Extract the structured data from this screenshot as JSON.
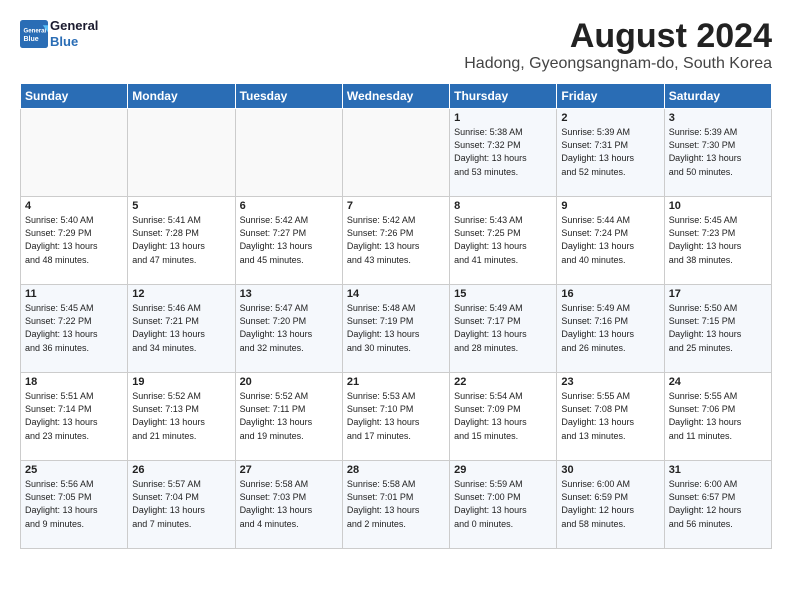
{
  "header": {
    "logo_line1": "General",
    "logo_line2": "Blue",
    "month_title": "August 2024",
    "subtitle": "Hadong, Gyeongsangnam-do, South Korea"
  },
  "weekdays": [
    "Sunday",
    "Monday",
    "Tuesday",
    "Wednesday",
    "Thursday",
    "Friday",
    "Saturday"
  ],
  "weeks": [
    [
      {
        "day": "",
        "content": ""
      },
      {
        "day": "",
        "content": ""
      },
      {
        "day": "",
        "content": ""
      },
      {
        "day": "",
        "content": ""
      },
      {
        "day": "1",
        "content": "Sunrise: 5:38 AM\nSunset: 7:32 PM\nDaylight: 13 hours\nand 53 minutes."
      },
      {
        "day": "2",
        "content": "Sunrise: 5:39 AM\nSunset: 7:31 PM\nDaylight: 13 hours\nand 52 minutes."
      },
      {
        "day": "3",
        "content": "Sunrise: 5:39 AM\nSunset: 7:30 PM\nDaylight: 13 hours\nand 50 minutes."
      }
    ],
    [
      {
        "day": "4",
        "content": "Sunrise: 5:40 AM\nSunset: 7:29 PM\nDaylight: 13 hours\nand 48 minutes."
      },
      {
        "day": "5",
        "content": "Sunrise: 5:41 AM\nSunset: 7:28 PM\nDaylight: 13 hours\nand 47 minutes."
      },
      {
        "day": "6",
        "content": "Sunrise: 5:42 AM\nSunset: 7:27 PM\nDaylight: 13 hours\nand 45 minutes."
      },
      {
        "day": "7",
        "content": "Sunrise: 5:42 AM\nSunset: 7:26 PM\nDaylight: 13 hours\nand 43 minutes."
      },
      {
        "day": "8",
        "content": "Sunrise: 5:43 AM\nSunset: 7:25 PM\nDaylight: 13 hours\nand 41 minutes."
      },
      {
        "day": "9",
        "content": "Sunrise: 5:44 AM\nSunset: 7:24 PM\nDaylight: 13 hours\nand 40 minutes."
      },
      {
        "day": "10",
        "content": "Sunrise: 5:45 AM\nSunset: 7:23 PM\nDaylight: 13 hours\nand 38 minutes."
      }
    ],
    [
      {
        "day": "11",
        "content": "Sunrise: 5:45 AM\nSunset: 7:22 PM\nDaylight: 13 hours\nand 36 minutes."
      },
      {
        "day": "12",
        "content": "Sunrise: 5:46 AM\nSunset: 7:21 PM\nDaylight: 13 hours\nand 34 minutes."
      },
      {
        "day": "13",
        "content": "Sunrise: 5:47 AM\nSunset: 7:20 PM\nDaylight: 13 hours\nand 32 minutes."
      },
      {
        "day": "14",
        "content": "Sunrise: 5:48 AM\nSunset: 7:19 PM\nDaylight: 13 hours\nand 30 minutes."
      },
      {
        "day": "15",
        "content": "Sunrise: 5:49 AM\nSunset: 7:17 PM\nDaylight: 13 hours\nand 28 minutes."
      },
      {
        "day": "16",
        "content": "Sunrise: 5:49 AM\nSunset: 7:16 PM\nDaylight: 13 hours\nand 26 minutes."
      },
      {
        "day": "17",
        "content": "Sunrise: 5:50 AM\nSunset: 7:15 PM\nDaylight: 13 hours\nand 25 minutes."
      }
    ],
    [
      {
        "day": "18",
        "content": "Sunrise: 5:51 AM\nSunset: 7:14 PM\nDaylight: 13 hours\nand 23 minutes."
      },
      {
        "day": "19",
        "content": "Sunrise: 5:52 AM\nSunset: 7:13 PM\nDaylight: 13 hours\nand 21 minutes."
      },
      {
        "day": "20",
        "content": "Sunrise: 5:52 AM\nSunset: 7:11 PM\nDaylight: 13 hours\nand 19 minutes."
      },
      {
        "day": "21",
        "content": "Sunrise: 5:53 AM\nSunset: 7:10 PM\nDaylight: 13 hours\nand 17 minutes."
      },
      {
        "day": "22",
        "content": "Sunrise: 5:54 AM\nSunset: 7:09 PM\nDaylight: 13 hours\nand 15 minutes."
      },
      {
        "day": "23",
        "content": "Sunrise: 5:55 AM\nSunset: 7:08 PM\nDaylight: 13 hours\nand 13 minutes."
      },
      {
        "day": "24",
        "content": "Sunrise: 5:55 AM\nSunset: 7:06 PM\nDaylight: 13 hours\nand 11 minutes."
      }
    ],
    [
      {
        "day": "25",
        "content": "Sunrise: 5:56 AM\nSunset: 7:05 PM\nDaylight: 13 hours\nand 9 minutes."
      },
      {
        "day": "26",
        "content": "Sunrise: 5:57 AM\nSunset: 7:04 PM\nDaylight: 13 hours\nand 7 minutes."
      },
      {
        "day": "27",
        "content": "Sunrise: 5:58 AM\nSunset: 7:03 PM\nDaylight: 13 hours\nand 4 minutes."
      },
      {
        "day": "28",
        "content": "Sunrise: 5:58 AM\nSunset: 7:01 PM\nDaylight: 13 hours\nand 2 minutes."
      },
      {
        "day": "29",
        "content": "Sunrise: 5:59 AM\nSunset: 7:00 PM\nDaylight: 13 hours\nand 0 minutes."
      },
      {
        "day": "30",
        "content": "Sunrise: 6:00 AM\nSunset: 6:59 PM\nDaylight: 12 hours\nand 58 minutes."
      },
      {
        "day": "31",
        "content": "Sunrise: 6:00 AM\nSunset: 6:57 PM\nDaylight: 12 hours\nand 56 minutes."
      }
    ]
  ]
}
